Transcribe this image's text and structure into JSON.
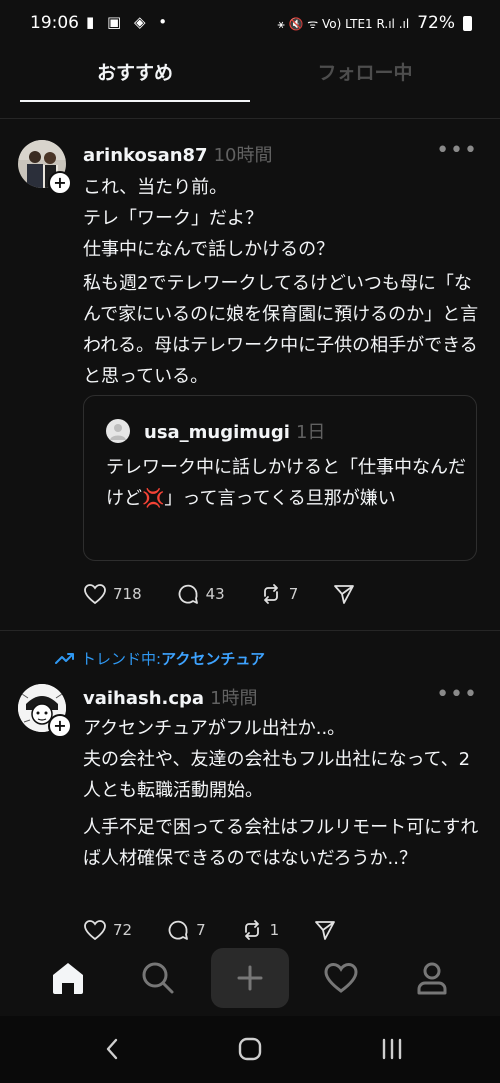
{
  "status_bar": {
    "time": "19:06",
    "left_icons": "▮ ▣ ◈ •",
    "network": "⚹ 🔇 ᯤ Vo) LTE1 R.ıl .ıl",
    "battery": "72%"
  },
  "tabs": {
    "recommended": "おすすめ",
    "following": "フォロー中"
  },
  "posts": [
    {
      "username": "arinkosan87",
      "time": "10時間",
      "text1": "これ、当たり前。\nテレ「ワーク」だよ？\n仕事中になんで話しかけるの？",
      "text2": "私も週2でテレワークしてるけどいつも母に「なんで家にいるのに娘を保育園に預けるのか」と言われる。母はテレワーク中に子供の相手ができると思っている。",
      "quote": {
        "username": "usa_mugimugi",
        "time": "1日",
        "text": "テレワーク中に話しかけると「仕事中なんだけど💢」って言ってくる旦那が嫌い"
      },
      "likes": "718",
      "replies": "43",
      "reposts": "7"
    },
    {
      "trend_label": "トレンド中:",
      "trend_term": "アクセンチュア",
      "username": "vaihash.cpa",
      "time": "1時間",
      "text1": "アクセンチュアがフル出社か..。\n夫の会社や、友達の会社もフル出社になって、2人とも転職活動開始。",
      "text2": "人手不足で困ってる会社はフルリモート可にすれば人材確保できるのではないだろうか..？",
      "likes": "72",
      "replies": "7",
      "reposts": "1"
    }
  ],
  "icons": {
    "more": "•••",
    "avatar_plus": "+"
  },
  "colors": {
    "background": "#101010",
    "trend_blue": "#2f98f2",
    "muted": "#616161"
  }
}
